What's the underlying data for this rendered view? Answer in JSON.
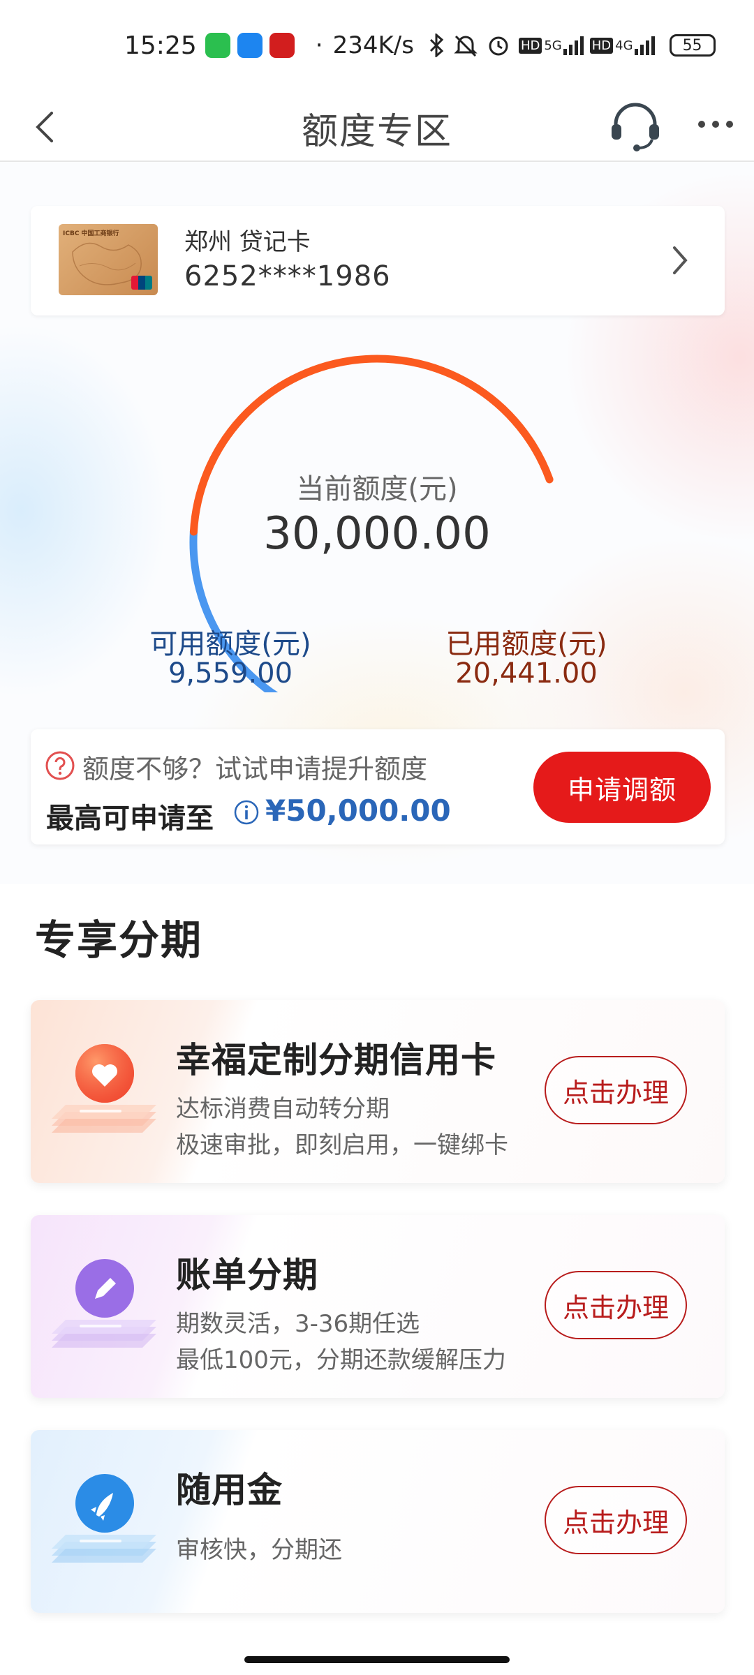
{
  "status_bar": {
    "time": "15:25",
    "speed": "234K/s",
    "battery": "55",
    "signal_labels": [
      "HD",
      "5G",
      "HD",
      "4G"
    ],
    "icons": [
      "wechat-icon",
      "alipay-icon",
      "icbc-app-icon",
      "bluetooth-icon",
      "mute-icon",
      "alarm-icon",
      "signal-icon",
      "battery-icon"
    ]
  },
  "nav": {
    "title": "额度专区",
    "icons": [
      "back-icon",
      "customer-service-icon",
      "more-icon"
    ]
  },
  "card": {
    "name": "郑州 贷记卡",
    "number": "6252****1986",
    "image_text": "ICBC 中国工商银行"
  },
  "gauge": {
    "label": "当前额度(元)",
    "total": "30,000.00",
    "available_label": "可用额度(元)",
    "available": "9,559.00",
    "used_label": "已用额度(元)",
    "used": "20,441.00",
    "used_fraction": 0.6814,
    "colors": {
      "available": "#4a97f0",
      "used": "#fb5a1f"
    }
  },
  "increase": {
    "hint": "额度不够？试试申请提升额度",
    "max_label": "最高可申请至",
    "max_amount": "¥50,000.00",
    "apply_label": "申请调额"
  },
  "section": {
    "title": "专享分期"
  },
  "products": [
    {
      "title": "幸福定制分期信用卡",
      "desc": [
        "达标消费自动转分期",
        "极速审批，即刻启用，一键绑卡"
      ],
      "button": "点击办理",
      "icon": "heart-icon",
      "color": "#f5603c"
    },
    {
      "title": "账单分期",
      "desc": [
        "期数灵活，3-36期任选",
        "最低100元，分期还款缓解压力"
      ],
      "button": "点击办理",
      "icon": "pencil-icon",
      "color": "#9a6ee6"
    },
    {
      "title": "随用金",
      "desc": [
        "审核快，分期还"
      ],
      "button": "点击办理",
      "icon": "rocket-icon",
      "color": "#2b8ce6"
    }
  ],
  "accent": {
    "primary_red": "#e51a1a",
    "button_outline": "#b81c1c",
    "link_blue": "#2a66b8"
  }
}
